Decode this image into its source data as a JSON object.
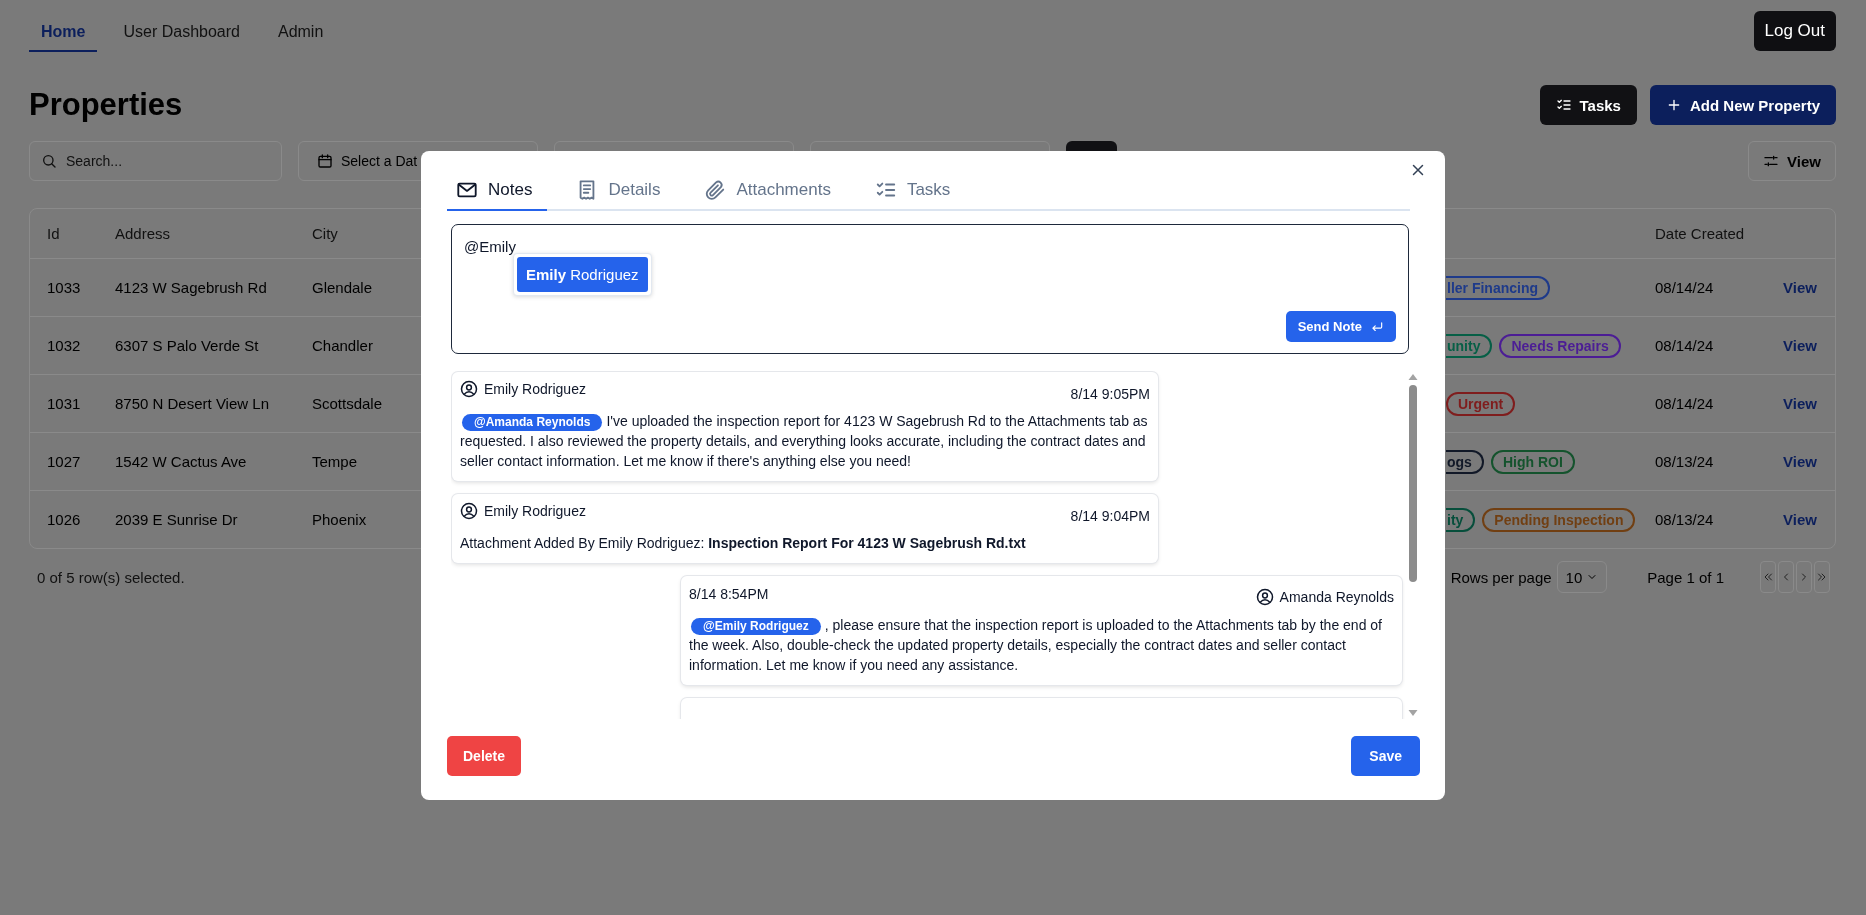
{
  "nav": {
    "tabs": [
      {
        "label": "Home",
        "selected": true
      },
      {
        "label": "User Dashboard",
        "selected": false
      },
      {
        "label": "Admin",
        "selected": false
      }
    ],
    "logout": "Log Out"
  },
  "header": {
    "title": "Properties",
    "buttons": [
      {
        "label": "Tasks",
        "kind": "tasks"
      },
      {
        "label": "Add New Property",
        "kind": "add"
      }
    ]
  },
  "filters": {
    "search_placeholder": "Search...",
    "date_placeholder": "Select a Dat",
    "view_button": "View"
  },
  "table": {
    "columns": {
      "id": "Id",
      "address": "Address",
      "city": "City",
      "date": "Date Created"
    },
    "rows": [
      {
        "id": "1033",
        "address": "4123 W Sagebrush Rd",
        "city": "Glendale",
        "tags": [
          {
            "label": "ller Financing",
            "color": "#1e3a8a",
            "clipped": true
          }
        ],
        "date": "08/14/24",
        "action": "View"
      },
      {
        "id": "1032",
        "address": "6307 S Palo Verde St",
        "city": "Chandler",
        "tags": [
          {
            "label": "unity",
            "color": "#065f46",
            "clipped": true
          },
          {
            "label": "Needs Repairs",
            "color": "#4c1d95",
            "clipped": false
          }
        ],
        "date": "08/14/24",
        "action": "View"
      },
      {
        "id": "1031",
        "address": "8750 N Desert View Ln",
        "city": "Scottsdale",
        "tags": [
          {
            "label": "Urgent",
            "color": "#7f1d1d",
            "clipped": false
          }
        ],
        "date": "08/14/24",
        "action": "View"
      },
      {
        "id": "1027",
        "address": "1542 W Cactus Ave",
        "city": "Tempe",
        "tags": [
          {
            "label": "ogs",
            "color": "#111827",
            "clipped": true
          },
          {
            "label": "High ROI",
            "color": "#14532d",
            "clipped": false
          }
        ],
        "date": "08/13/24",
        "action": "View"
      },
      {
        "id": "1026",
        "address": "2039 E Sunrise Dr",
        "city": "Phoenix",
        "tags": [
          {
            "label": "ity",
            "color": "#064e3b",
            "clipped": true
          },
          {
            "label": "Pending Inspection",
            "color": "#713f12",
            "clipped": false
          }
        ],
        "date": "08/13/24",
        "action": "View"
      }
    ],
    "selected_text": "0 of 5 row(s) selected.",
    "rows_per_page": "Rows per page",
    "page_size": "10",
    "page_info": "Page 1 of 1"
  },
  "modal": {
    "tabs": [
      {
        "label": "Notes",
        "selected": true
      },
      {
        "label": "Details",
        "selected": false
      },
      {
        "label": "Attachments",
        "selected": false
      },
      {
        "label": "Tasks",
        "selected": false
      }
    ],
    "note": {
      "value": "@Emily",
      "suggestions": [
        {
          "label": "**Emily** Rodriguez",
          "selected": true
        }
      ],
      "send": "Send Note"
    },
    "messages": [
      {
        "author": "Emily Rodriguez",
        "time": "8/14 9:05PM",
        "outgoing": false,
        "mention": "@Amanda Reynolds",
        "text": "I've uploaded the inspection report for 4123 W Sagebrush Rd to the Attachments tab as requested. I also reviewed the property details, and everything looks accurate, including the contract dates and seller contact information. Let me know if there's anything else you need!"
      },
      {
        "author": "Emily Rodriguez",
        "time": "8/14 9:04PM",
        "outgoing": false,
        "text": "Attachment Added By Emily Rodriguez: **Inspection Report For 4123 W Sagebrush Rd.txt**"
      },
      {
        "author": "Amanda Reynolds",
        "time": "8/14 8:54PM",
        "outgoing": true,
        "mention": "@Emily Rodriguez",
        "text": ", please ensure that the inspection report is uploaded to the Attachments tab by the end of the week. Also, double-check the updated property details, especially the contract dates and seller contact information. Let me know if you need any assistance."
      }
    ],
    "delete": "Delete",
    "save": "Save"
  }
}
